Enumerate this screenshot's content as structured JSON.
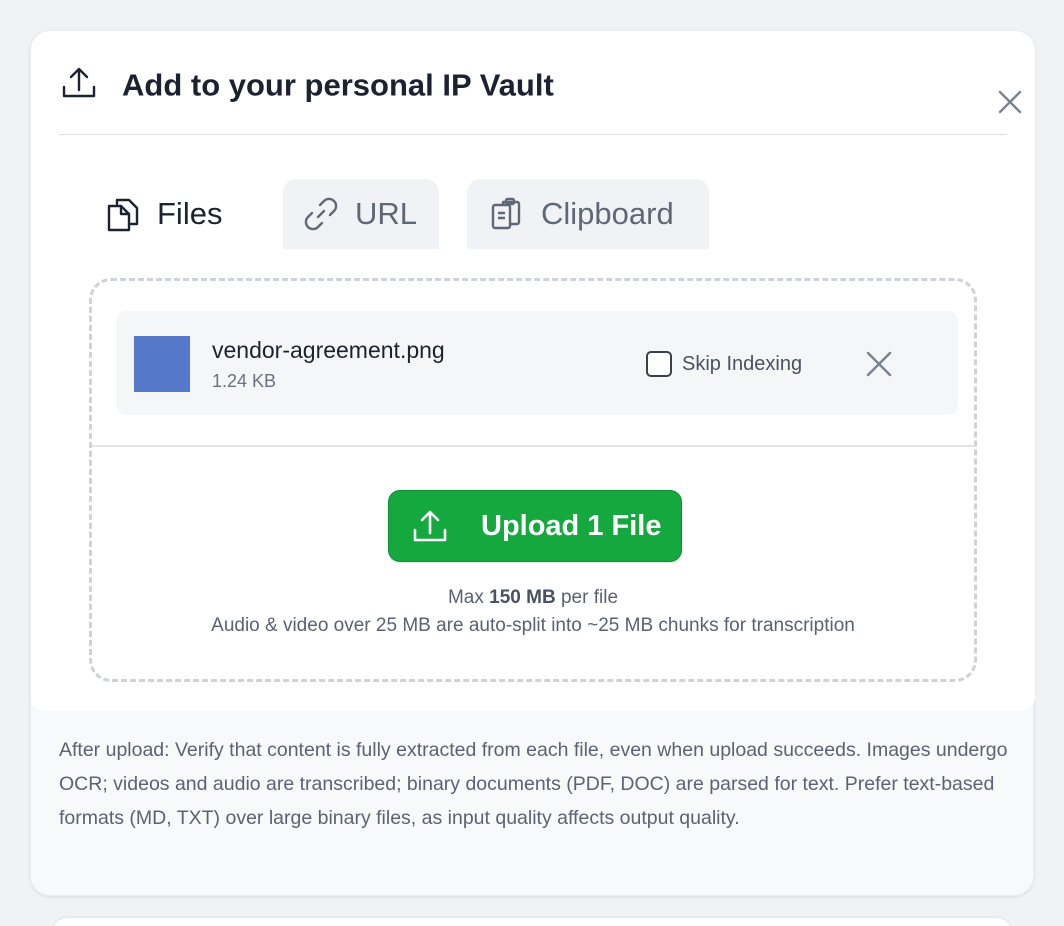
{
  "modal": {
    "title": "Add to your personal IP Vault"
  },
  "tabs": [
    {
      "label": "Files",
      "icon": "files-icon",
      "active": true
    },
    {
      "label": "URL",
      "icon": "link-icon",
      "active": false
    },
    {
      "label": "Clipboard",
      "icon": "clipboard-icon",
      "active": false
    }
  ],
  "file": {
    "name": "vendor-agreement.png",
    "size": "1.24 KB",
    "thumb_color": "#5578c9",
    "skip_label": "Skip Indexing",
    "skip_checked": false
  },
  "upload": {
    "button_label": "Upload 1 File",
    "button_color": "#15a83f",
    "max_prefix": "Max ",
    "max_value": "150 MB",
    "max_suffix": " per file",
    "split_note": "Audio & video over 25 MB are auto-split into ~25 MB chunks for transcription"
  },
  "info_text": "After upload: Verify that content is fully extracted from each file, even when upload succeeds. Images undergo OCR; videos and audio are transcribed; binary documents (PDF, DOC) are parsed for text. Prefer text-based formats (MD, TXT) over large binary files, as input quality affects output quality."
}
